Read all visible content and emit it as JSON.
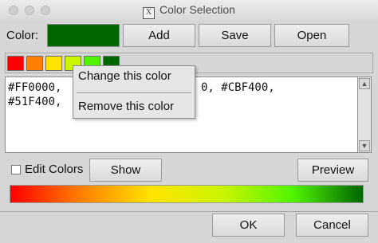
{
  "window": {
    "title": "Color Selection",
    "title_icon": "x11-icon"
  },
  "toolbar": {
    "color_label": "Color:",
    "current_color": "#006600",
    "add_label": "Add",
    "save_label": "Save",
    "open_label": "Open"
  },
  "swatches": [
    {
      "color": "#FF0000"
    },
    {
      "color": "#FF7F00"
    },
    {
      "color": "#FFE400"
    },
    {
      "color": "#CBF400"
    },
    {
      "color": "#51F400"
    },
    {
      "color": "#006600"
    }
  ],
  "color_list": {
    "line1_visible": "#FF0000,",
    "line1_tail": "0, #CBF400,",
    "line2_visible": "#51F400,"
  },
  "context_menu": {
    "items": [
      "Change this color",
      "Remove this color"
    ]
  },
  "options": {
    "edit_colors_label": "Edit Colors",
    "edit_colors_checked": false,
    "show_label": "Show",
    "preview_label": "Preview"
  },
  "gradient_colors": [
    "#FF0000",
    "#FF7F00",
    "#FFE400",
    "#CBF400",
    "#51F400",
    "#006600"
  ],
  "footer": {
    "ok_label": "OK",
    "cancel_label": "Cancel"
  }
}
